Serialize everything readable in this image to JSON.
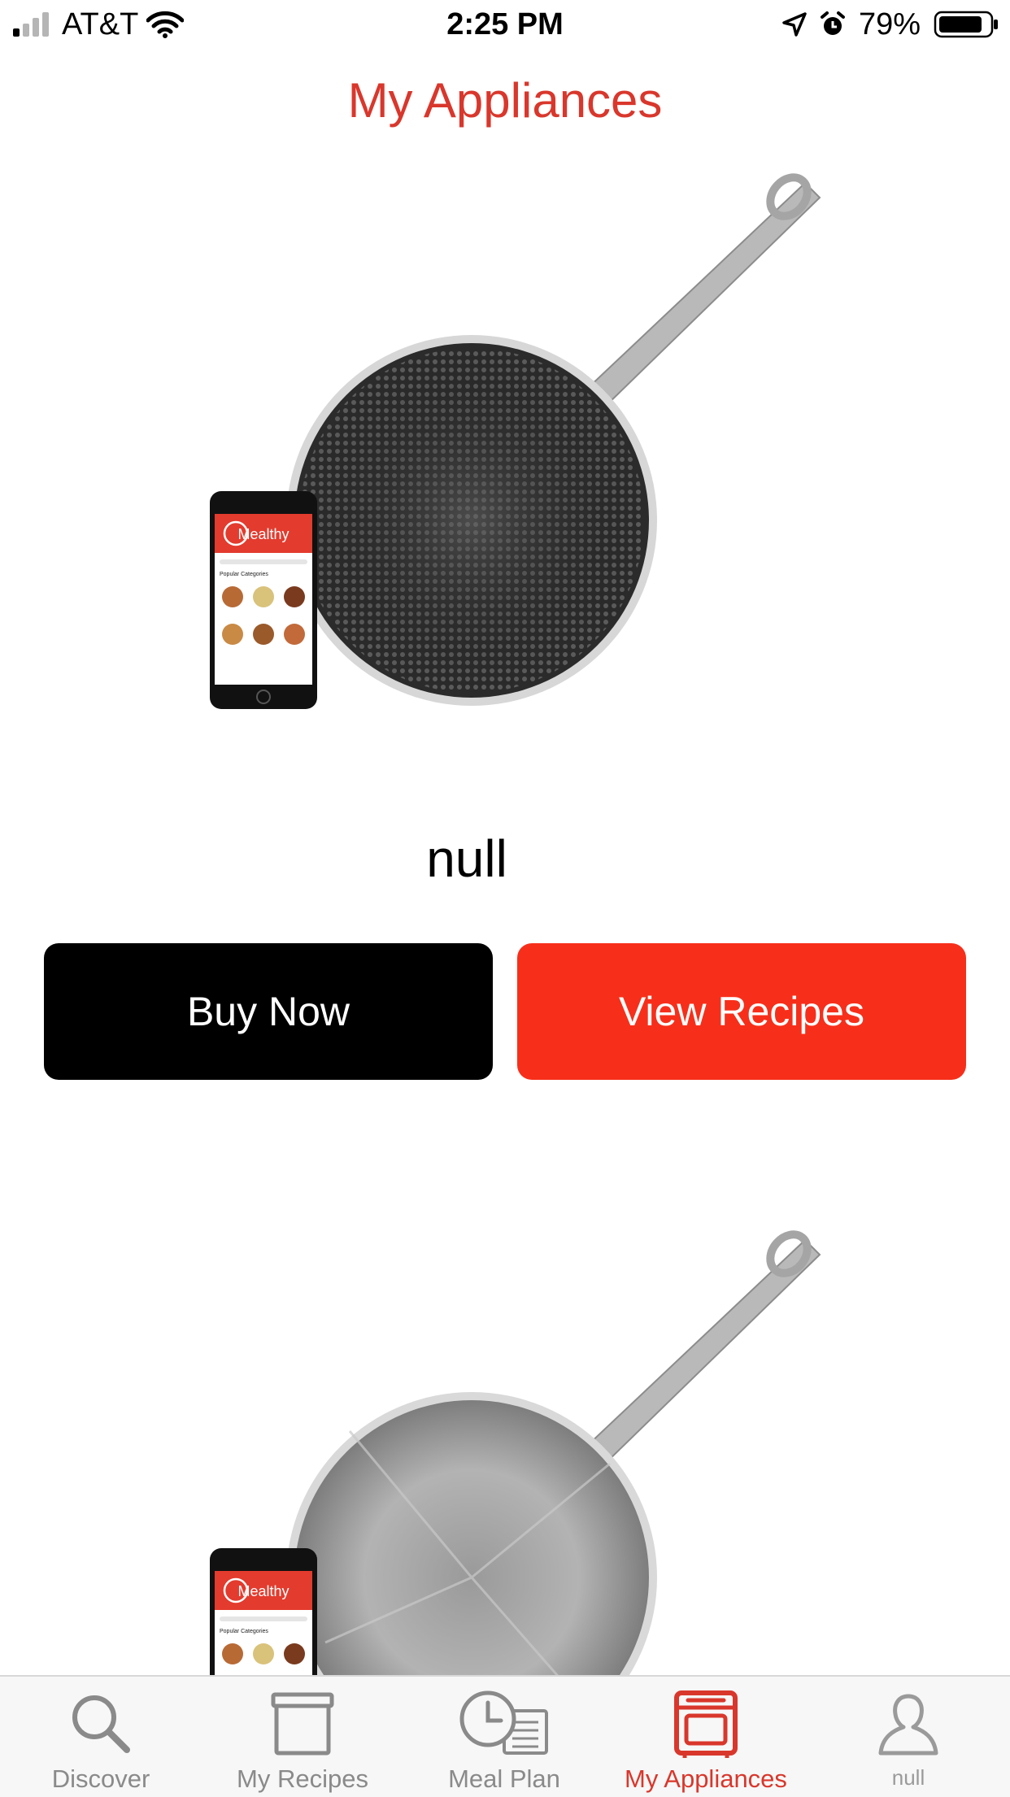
{
  "status_bar": {
    "carrier": "AT&T",
    "time": "2:25 PM",
    "battery": "79%"
  },
  "header": {
    "title": "My Appliances"
  },
  "appliances": [
    {
      "name": "null",
      "phone_app_logo": "Mealthy",
      "phone_app_section": "Popular Categories",
      "buy_label": "Buy Now",
      "recipes_label": "View Recipes"
    },
    {
      "phone_app_logo": "Mealthy",
      "phone_app_section": "Popular Categories"
    }
  ],
  "tabs": [
    {
      "label": "Discover",
      "icon": "search-icon"
    },
    {
      "label": "My Recipes",
      "icon": "recipe-box-icon"
    },
    {
      "label": "Meal Plan",
      "icon": "meal-plan-clock-icon"
    },
    {
      "label": "My Appliances",
      "icon": "oven-icon",
      "active": true
    },
    {
      "label": "null",
      "icon": "profile-icon"
    }
  ],
  "colors": {
    "brand": "#d9372c",
    "view_recipes_button": "#f72f1a",
    "buy_button": "#000000",
    "tab_inactive": "#8a8a8a",
    "tab_bar_bg": "#f7f7f7"
  }
}
